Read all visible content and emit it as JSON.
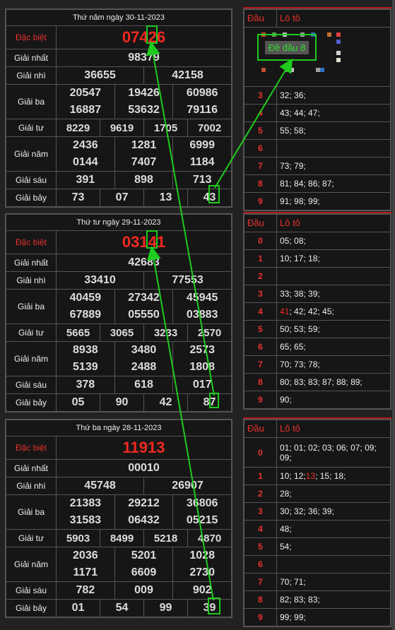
{
  "col_headers": {
    "dau": "Đầu",
    "loto": "Lô tô"
  },
  "ad_text": "Đề đầu 8",
  "sections": [
    {
      "header": "Thứ năm ngày 30-11-2023",
      "db": "07426",
      "g1": "98379",
      "g2": [
        "36655",
        "42158"
      ],
      "g3": [
        [
          "20547",
          "19426",
          "60986"
        ],
        [
          "16887",
          "53632",
          "79116"
        ]
      ],
      "g4": [
        "8229",
        "9619",
        "1705",
        "7002"
      ],
      "g5": [
        [
          "2436",
          "1281",
          "6999"
        ],
        [
          "0144",
          "7407",
          "1184"
        ]
      ],
      "g6": [
        "391",
        "898",
        "713"
      ],
      "g7": [
        "73",
        "07",
        "13",
        "43"
      ],
      "loto": [
        {
          "d": "3",
          "v": "32; 36;"
        },
        {
          "d": "4",
          "v": "43; 44; 47;"
        },
        {
          "d": "5",
          "v": "55; 58;"
        },
        {
          "d": "6",
          "v": ""
        },
        {
          "d": "7",
          "v": "73; 79;"
        },
        {
          "d": "8",
          "v": "81; 84; 86; 87;"
        },
        {
          "d": "9",
          "v": "91; 98; 99;"
        }
      ]
    },
    {
      "header": "Thứ tư ngày 29-11-2023",
      "db": "03141",
      "g1": "42683",
      "g2": [
        "33410",
        "77553"
      ],
      "g3": [
        [
          "40459",
          "27342",
          "45945"
        ],
        [
          "67889",
          "05550",
          "03883"
        ]
      ],
      "g4": [
        "5665",
        "3065",
        "3233",
        "2570"
      ],
      "g5": [
        [
          "8938",
          "3480",
          "2573"
        ],
        [
          "5139",
          "2488",
          "1808"
        ]
      ],
      "g6": [
        "378",
        "618",
        "017"
      ],
      "g7": [
        "05",
        "90",
        "42",
        "87"
      ],
      "loto": [
        {
          "d": "0",
          "v": "05; 08;"
        },
        {
          "d": "1",
          "v": "10; 17; 18;"
        },
        {
          "d": "2",
          "v": ""
        },
        {
          "d": "3",
          "v": "33; 38; 39;"
        },
        {
          "d": "4",
          "pre": "41",
          "v": "; 42; 42; 45;"
        },
        {
          "d": "5",
          "v": "50; 53; 59;"
        },
        {
          "d": "6",
          "v": "65; 65;"
        },
        {
          "d": "7",
          "v": "70; 73; 78;"
        },
        {
          "d": "8",
          "v": "80; 83; 83; 87; 88; 89;"
        },
        {
          "d": "9",
          "v": "90;"
        }
      ]
    },
    {
      "header": "Thứ ba ngày 28-11-2023",
      "db": "11913",
      "g1": "00010",
      "g2": [
        "45748",
        "26907"
      ],
      "g3": [
        [
          "21383",
          "29212",
          "36806"
        ],
        [
          "31583",
          "06432",
          "05215"
        ]
      ],
      "g4": [
        "5903",
        "8499",
        "5218",
        "4870"
      ],
      "g5": [
        [
          "2036",
          "5201",
          "1028"
        ],
        [
          "1171",
          "6609",
          "2730"
        ]
      ],
      "g6": [
        "782",
        "009",
        "902"
      ],
      "g7": [
        "01",
        "54",
        "99",
        "39"
      ],
      "loto": [
        {
          "d": "0",
          "v": "01; 01; 02; 03; 06; 07; 09; 09;"
        },
        {
          "d": "1",
          "v": "10; 12; ",
          "hl": "13",
          "post": "; 15; 18;"
        },
        {
          "d": "2",
          "v": "28;"
        },
        {
          "d": "3",
          "v": "30; 32; 36; 39;"
        },
        {
          "d": "4",
          "v": "48;"
        },
        {
          "d": "5",
          "v": "54;"
        },
        {
          "d": "6",
          "v": ""
        },
        {
          "d": "7",
          "v": "70; 71;"
        },
        {
          "d": "8",
          "v": "82; 83; 83;"
        },
        {
          "d": "9",
          "v": "99; 99;"
        }
      ]
    }
  ],
  "labels": {
    "db": "Đặc biệt",
    "g1": "Giải nhất",
    "g2": "Giải nhì",
    "g3": "Giải ba",
    "g4": "Giải tư",
    "g5": "Giải năm",
    "g6": "Giải sáu",
    "g7": "Giải bảy"
  },
  "colors": {
    "accent_red": "#f02a20",
    "arrow_green": "#1ecb1e"
  }
}
